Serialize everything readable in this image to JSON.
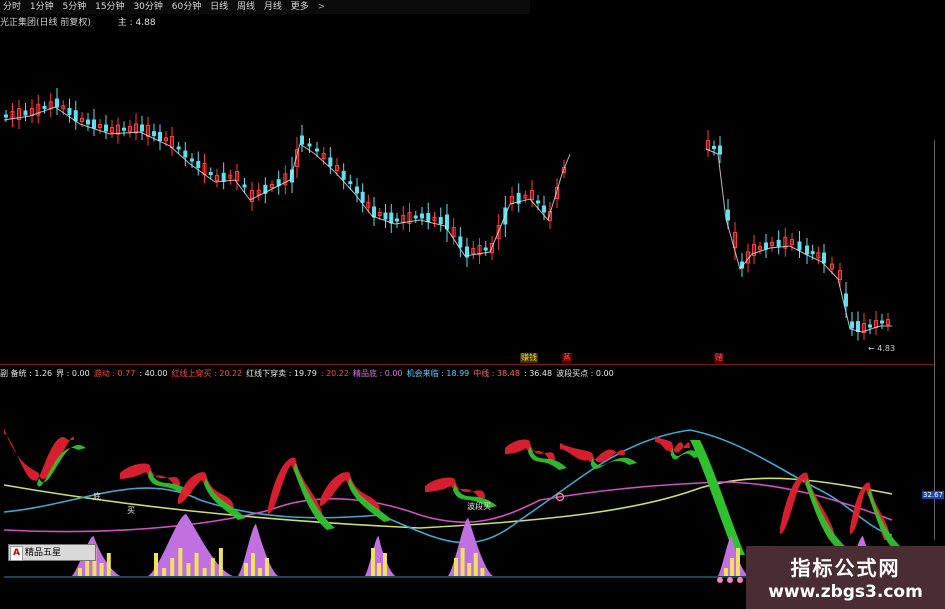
{
  "toolbar": {
    "items": [
      "分时",
      "1分钟",
      "5分钟",
      "15分钟",
      "30分钟",
      "60分钟",
      "日线",
      "周线",
      "月线",
      "更多"
    ],
    "more_arrow": ">"
  },
  "title_bar": {
    "name": "光正集团(日线 前复权)",
    "main_value": "主 : 4.88"
  },
  "indicator_bar": {
    "entries": [
      {
        "label": "副 备统 : 1.26",
        "color": "#e8e8e8"
      },
      {
        "label": "界 : 0.00",
        "color": "#e8e8e8"
      },
      {
        "label": "游动 : 0.77",
        "color": "#ff4a4a"
      },
      {
        "label": ": 40.00",
        "color": "#e8e8e8"
      },
      {
        "label": "红线上穿买 : 20.22",
        "color": "#ff4a4a"
      },
      {
        "label": "红线下穿卖 : 19.79",
        "color": "#e8e8e8"
      },
      {
        "label": ": 20.22",
        "color": "#ff4a4a"
      },
      {
        "label": "精品底 : 0.00",
        "color": "#e070e0"
      },
      {
        "label": "机会来临 : 18.99",
        "color": "#5fd0ff"
      },
      {
        "label": "中线 : 38.48",
        "color": "#ff6a6a"
      },
      {
        "label": ": 36.48",
        "color": "#e8e8e8"
      },
      {
        "label": "波段买点 : 0.00",
        "color": "#e8e8e8"
      }
    ]
  },
  "chart_tags": {
    "tag_a": "赚钱",
    "tag_b": "蒸",
    "tag_c": "赌",
    "price_mark": "← 4.83",
    "lower_tag_1": "底",
    "lower_tag_2": "波段买",
    "lower_tag_3": "买",
    "right_axis_value": "32.67"
  },
  "logo": {
    "badge": "A",
    "text": "精品五星"
  },
  "watermark": {
    "title": "指标公式网",
    "url": "www.zbgs3.com"
  },
  "colors": {
    "up_candle": "#ff3c3c",
    "down_candle": "#5ee0f0",
    "fill_red": "#e02030",
    "fill_green": "#30c030",
    "line_cyan": "#40a8d0",
    "line_yellowgreen": "#c8e070",
    "line_magenta": "#d050c0",
    "hist_violet": "#c070e0",
    "bar_yellow": "#f0e060"
  }
}
